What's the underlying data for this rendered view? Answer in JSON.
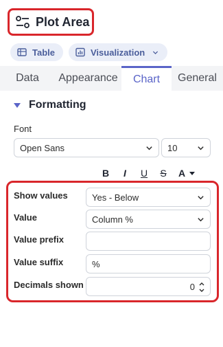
{
  "header": {
    "title": "Plot Area"
  },
  "view_toggle": {
    "table_label": "Table",
    "visualization_label": "Visualization"
  },
  "tabs": [
    {
      "label": "Data"
    },
    {
      "label": "Appearance"
    },
    {
      "label": "Chart",
      "active": true
    },
    {
      "label": "General"
    }
  ],
  "section": {
    "title": "Formatting"
  },
  "font": {
    "label": "Font",
    "family": "Open Sans",
    "size": "10"
  },
  "text_format": {
    "bold": "B",
    "italic": "I",
    "underline": "U",
    "strike": "S",
    "color": "A"
  },
  "fields": {
    "show_values_label": "Show values",
    "show_values_value": "Yes - Below",
    "value_label": "Value",
    "value_value": "Column %",
    "prefix_label": "Value prefix",
    "prefix_value": "",
    "suffix_label": "Value suffix",
    "suffix_value": "%",
    "decimals_label": "Decimals shown",
    "decimals_value": "0"
  },
  "colors": {
    "accent": "#5a64c8",
    "highlight": "#d9262b",
    "pill_bg": "#eaeef8"
  }
}
